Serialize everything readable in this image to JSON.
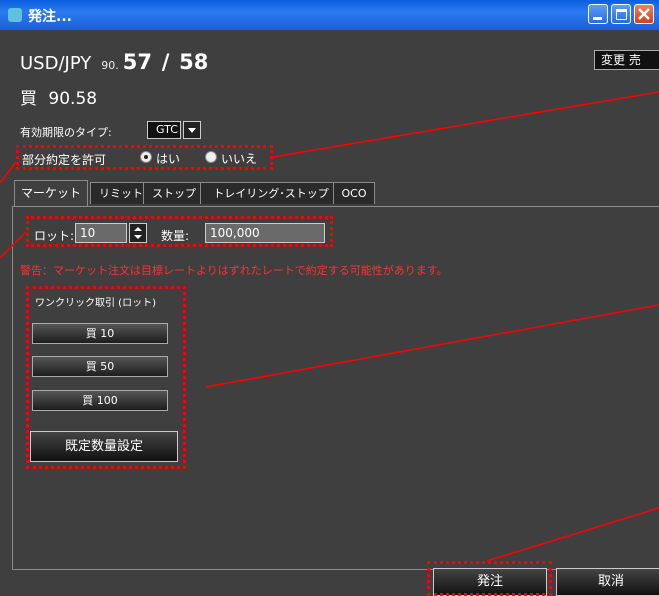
{
  "window": {
    "title": "発注...",
    "icon": "app-icon",
    "controls": [
      "minimize-icon",
      "maximize-icon",
      "close-icon"
    ]
  },
  "pair": {
    "symbol": "USD/JPY",
    "price_prefix": "90.",
    "price_bid": "57",
    "separator": "/",
    "price_ask": "58",
    "change_button": "変更 売"
  },
  "side_line": {
    "side": "買",
    "rate": "90.58"
  },
  "expiry": {
    "label": "有効期限のタイプ:",
    "selected": "GTC"
  },
  "partial_fill": {
    "label": "部分約定を許可",
    "options": [
      {
        "label": "はい",
        "selected": true
      },
      {
        "label": "いいえ",
        "selected": false
      }
    ]
  },
  "tabs": [
    {
      "label": "マーケット",
      "active": true
    },
    {
      "label": "リミット",
      "active": false
    },
    {
      "label": "ストップ",
      "active": false
    },
    {
      "label": "トレイリング･ストップ",
      "active": false
    },
    {
      "label": "OCO",
      "active": false
    }
  ],
  "order": {
    "lot_label": "ロット:",
    "lot_value": "10",
    "qty_label": "数量:",
    "qty_value": "100,000",
    "warning": "警告：マーケット注文は目標レートよりはずれたレートで約定する可能性があります。"
  },
  "oneclick": {
    "label": "ワンクリック取引 (ロット)",
    "buttons": [
      "買 10",
      "買 50",
      "買 100"
    ],
    "default_qty_button": "既定数量設定"
  },
  "footer": {
    "submit": "発注",
    "cancel": "取消"
  },
  "colors": {
    "background": "#3f3f3f",
    "titlebar": "#1a60d8",
    "warning": "#ff3030",
    "annotation": "#ff0000"
  }
}
